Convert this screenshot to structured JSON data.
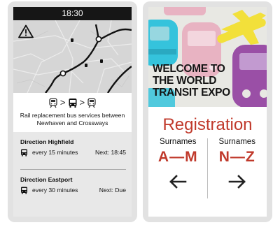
{
  "left_screen": {
    "status_time": "18:30",
    "notice": {
      "text": "Rail replacement bus services between Newhaven and Crossways"
    },
    "directions": [
      {
        "title": "Direction Highfield",
        "frequency": "every 15 minutes",
        "next": "Next: 18:45"
      },
      {
        "title": "Direction Eastport",
        "frequency": "every 30 minutes",
        "next": "Next: Due"
      }
    ]
  },
  "right_screen": {
    "welcome_lines": [
      "WELCOME TO",
      "THE WORLD",
      "TRANSIT EXPO"
    ],
    "registration_title": "Registration",
    "columns": [
      {
        "label": "Surnames",
        "range": "A—M",
        "arrow": "arrow-left-icon"
      },
      {
        "label": "Surnames",
        "range": "N—Z",
        "arrow": "arrow-right-icon"
      }
    ]
  },
  "colors": {
    "accent_red": "#c0392b",
    "status_bar": "#161616",
    "map_bg": "#d6d6d6",
    "departures_bg": "#e8e8e8",
    "poster_yellow": "#f2e03a",
    "poster_cyan": "#35c3dc",
    "poster_pink": "#e8b3c2",
    "poster_purple": "#9a4fa6"
  }
}
